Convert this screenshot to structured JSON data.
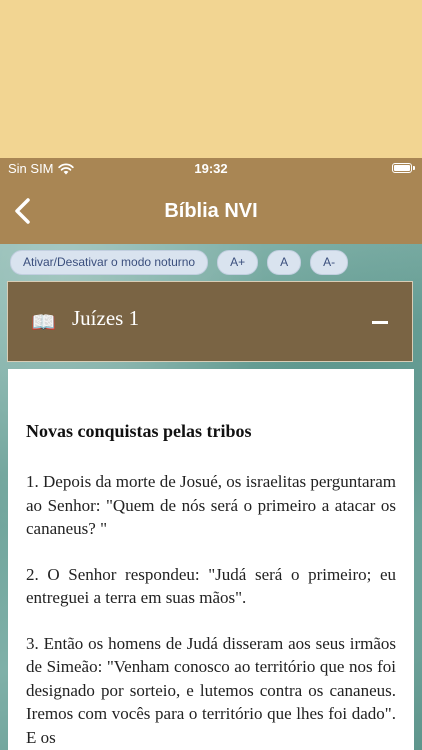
{
  "status": {
    "carrier": "Sin SIM",
    "time": "19:32"
  },
  "nav": {
    "title": "Bíblia NVI"
  },
  "toolbar": {
    "night_mode_label": "Ativar/Desativar o modo noturno",
    "font_increase_label": "A+",
    "font_reset_label": "A",
    "font_decrease_label": "A-"
  },
  "chapter": {
    "icon": "book-icon",
    "title": "Juízes 1"
  },
  "content": {
    "heading": "Novas conquistas pelas tribos",
    "verses": [
      "1. Depois da morte de Josué, os israelitas perguntaram ao Senhor: \"Quem de nós será o primeiro a atacar os cananeus? \"",
      "2. O Senhor respondeu: \"Judá será o primeiro; eu entreguei a terra em suas mãos\".",
      "3. Então os homens de Judá disseram aos seus irmãos de Simeão: \"Venham conosco ao território que nos foi designado por sorteio, e lutemos contra os cananeus. Iremos com vocês para o território que lhes foi dado\". E os"
    ]
  },
  "colors": {
    "top_band": "#f2d592",
    "nav_background": "#a98654",
    "chapter_header": "#7a6444",
    "pill_background": "#d9e3ef",
    "pill_text": "#3b4f7d"
  }
}
